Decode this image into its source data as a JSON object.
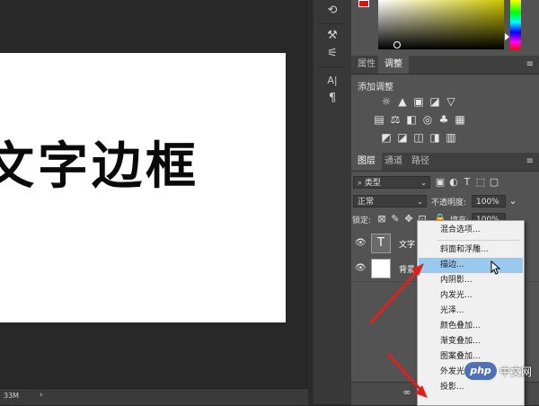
{
  "canvas": {
    "text": "文字边框",
    "doc_size": "33M",
    "status_arrow": "›"
  },
  "toolstrip": {
    "icons": [
      "history-icon",
      "brush-presets-icon",
      "adjustments-icon",
      "character-icon",
      "paragraph-icon"
    ]
  },
  "color": {
    "foreground": "#e01010"
  },
  "properties_tabs": [
    "属性",
    "调整"
  ],
  "adjustments": {
    "title": "添加调整",
    "row1": [
      "☼",
      "▲",
      "▣",
      "◪",
      "▽"
    ],
    "row2": [
      "▤",
      "⚖",
      "◧",
      "◎",
      "♣",
      "▦"
    ],
    "row3": [
      "◩",
      "◪",
      "◫",
      "◨",
      "▥"
    ]
  },
  "layers": {
    "tabs": [
      "图层",
      "通道",
      "路径"
    ],
    "filter": "类型",
    "blend_mode": "正常",
    "opacity_label": "不透明度:",
    "opacity_value": "100%",
    "lock_label": "锁定:",
    "fill_label": "填充:",
    "fill_value": "100%",
    "items": [
      {
        "name": "文字",
        "kind": "T"
      },
      {
        "name": "背景",
        "kind": ""
      }
    ],
    "footer_icon": "link-layers-icon"
  },
  "context_menu": {
    "items": [
      "混合选项...",
      "斜面和浮雕...",
      "描边...",
      "内阴影...",
      "内发光...",
      "光泽...",
      "颜色叠加...",
      "渐变叠加...",
      "图案叠加...",
      "外发光...",
      "投影..."
    ],
    "highlighted": "描边..."
  },
  "watermark": {
    "logo": "php",
    "text": "中文网"
  },
  "annotation_color": "#e0201c"
}
